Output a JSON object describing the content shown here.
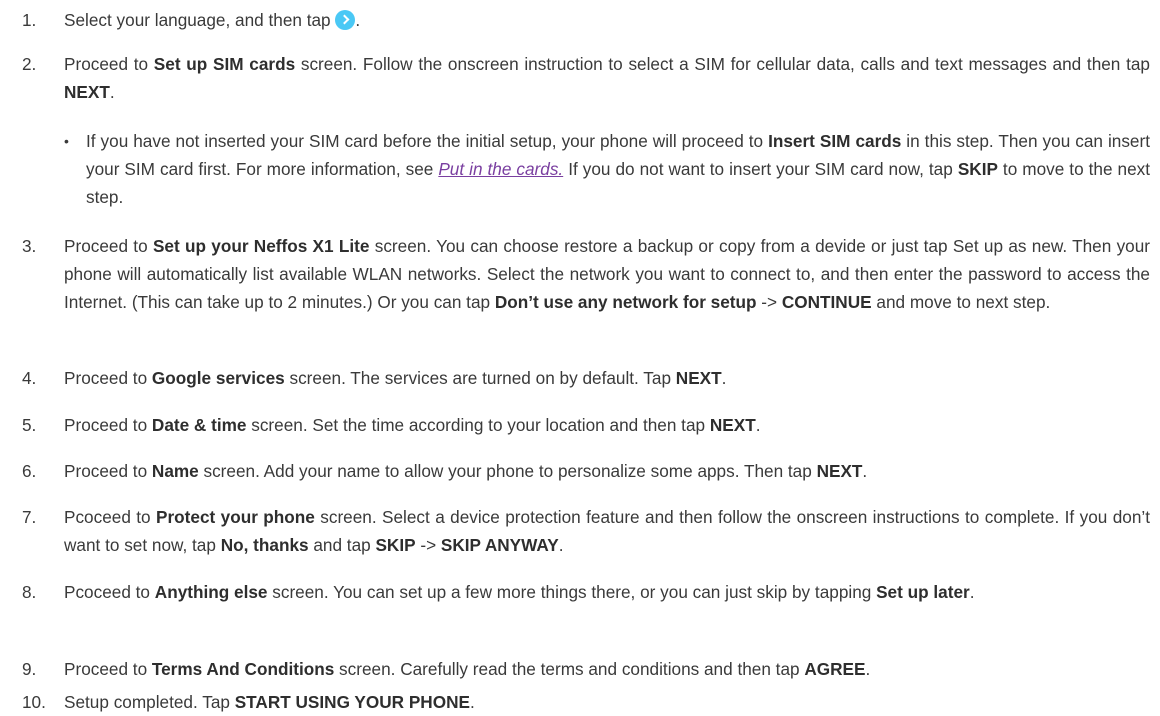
{
  "steps": [
    {
      "num": "1.",
      "a": "Select your language, and then tap ",
      "icon": "next-arrow-circle-icon",
      "b": "."
    },
    {
      "num": "2.",
      "a": "Proceed to ",
      "b": "Set up SIM cards",
      "c": " screen. Follow the onscreen instruction to select a SIM for cellular data, calls and text messages and then tap ",
      "d": "NEXT",
      "e": ".",
      "note": {
        "a": "If you have not inserted your SIM card before the initial setup, your phone will proceed to ",
        "b": "Insert SIM cards",
        "c": " in this step. Then you can insert your SIM card first. For more information, see ",
        "link": "Put in the cards.",
        "d": " If you do not want to insert your SIM card now, tap ",
        "e": "SKIP",
        "f": " to move to the next step."
      }
    },
    {
      "num": "3.",
      "a": "Proceed to ",
      "b": "Set up your Neffos X1 Lite",
      "c": " screen. You can choose restore a backup or copy from a devide or just tap Set up as new. Then your phone will automatically list available WLAN networks. Select the network you want to connect to, and then enter the password to access the Internet. (This can take up to 2 minutes.) Or you can tap ",
      "d": "Don’t use any network for setup",
      "e": " -> ",
      "f": "CONTINUE",
      "g": " and move to next step."
    },
    {
      "num": "4.",
      "a": "Proceed to ",
      "b": "Google services",
      "c": " screen. The services are turned on by default. Tap ",
      "d": "NEXT",
      "e": "."
    },
    {
      "num": "5.",
      "a": "Proceed to ",
      "b": "Date & time",
      "c": " screen. Set the time according to your location and then tap ",
      "d": "NEXT",
      "e": "."
    },
    {
      "num": "6.",
      "a": "Proceed to ",
      "b": "Name",
      "c": " screen. Add your name to allow your phone to personalize some apps. Then tap ",
      "d": "NEXT",
      "e": "."
    },
    {
      "num": "7.",
      "a": "Pcoceed to ",
      "b": "Protect your phone",
      "c": " screen. Select a device protection feature and then follow the onscreen instructions to complete. If you don’t want to set now, tap ",
      "d": "No, thanks",
      "e": " and tap ",
      "f": "SKIP",
      "g": " -> ",
      "h": "SKIP ANYWAY",
      "i": "."
    },
    {
      "num": "8.",
      "a": "Pcoceed to ",
      "b": "Anything else",
      "c": " screen. You can set up a few more things there, or you can just skip by tapping ",
      "d": "Set up later",
      "e": "."
    },
    {
      "num": "9.",
      "a": "Proceed to ",
      "b": "Terms And Conditions",
      "c": " screen. Carefully read the terms and conditions and then tap ",
      "d": "AGREE",
      "e": "."
    },
    {
      "num": "10.",
      "a": "Setup completed. Tap ",
      "b": "START USING YOUR PHONE",
      "c": "."
    }
  ],
  "note_bullet": "•",
  "accent_colors": {
    "icon": "#4ac8f5",
    "link": "#7a3fa0"
  }
}
